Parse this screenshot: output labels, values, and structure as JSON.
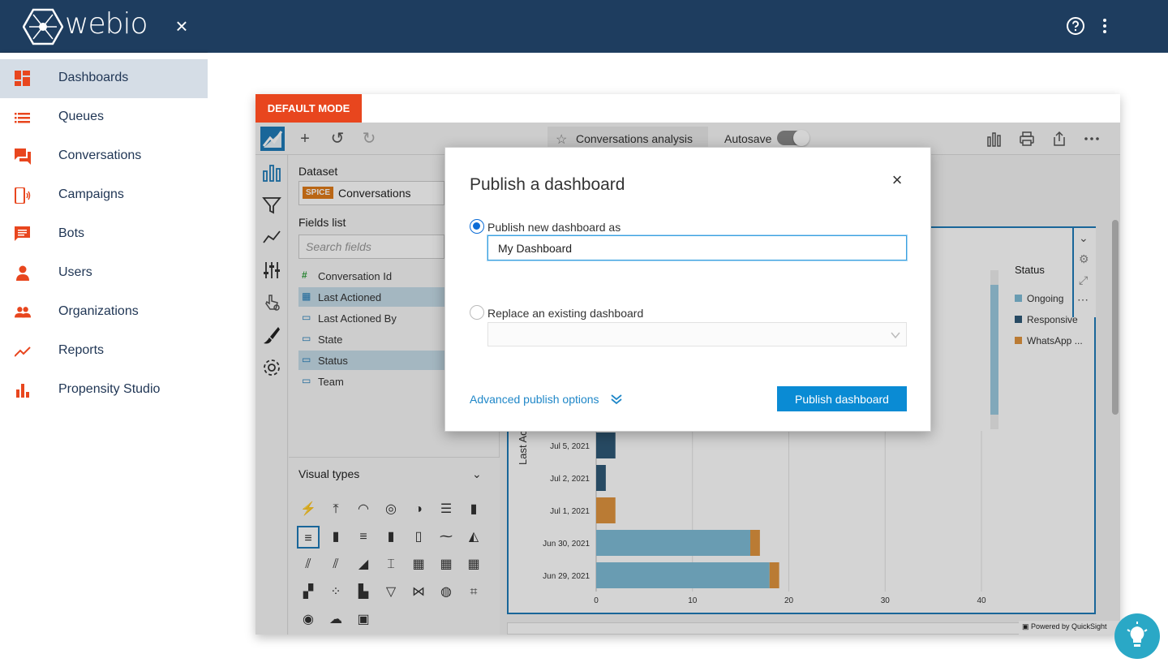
{
  "app": {
    "name": "webio",
    "close_label": "×"
  },
  "sidebar": {
    "items": [
      {
        "label": "Dashboards",
        "icon": "dashboard-icon"
      },
      {
        "label": "Queues",
        "icon": "list-icon"
      },
      {
        "label": "Conversations",
        "icon": "chat-icon"
      },
      {
        "label": "Campaigns",
        "icon": "phone-icon"
      },
      {
        "label": "Bots",
        "icon": "message-icon"
      },
      {
        "label": "Users",
        "icon": "person-icon"
      },
      {
        "label": "Organizations",
        "icon": "group-icon"
      },
      {
        "label": "Reports",
        "icon": "trend-icon"
      },
      {
        "label": "Propensity Studio",
        "icon": "bar-chart-icon"
      }
    ],
    "active_index": 0
  },
  "banner": {
    "mode_label": "DEFAULT MODE"
  },
  "quicksight": {
    "analysis_title": "Conversations analysis",
    "autosave_label": "Autosave",
    "dataset_label": "Dataset",
    "spice_badge": "SPICE",
    "dataset_name": "Conversations",
    "fields_list_label": "Fields list",
    "search_placeholder": "Search fields",
    "fields": [
      {
        "name": "Conversation Id",
        "type": "number",
        "selected": false
      },
      {
        "name": "Last Actioned",
        "type": "date",
        "selected": true
      },
      {
        "name": "Last Actioned By",
        "type": "dimension",
        "selected": false
      },
      {
        "name": "State",
        "type": "dimension",
        "selected": false
      },
      {
        "name": "Status",
        "type": "dimension",
        "selected": true
      },
      {
        "name": "Team",
        "type": "dimension",
        "selected": false
      }
    ],
    "visual_types_label": "Visual types",
    "powered_by": "Powered by QuickSight"
  },
  "chart_data": {
    "type": "bar",
    "orientation": "horizontal",
    "stacked": true,
    "ylabel": "Last Ac",
    "categories": [
      "Jul 5, 2021",
      "Jul 2, 2021",
      "Jul 1, 2021",
      "Jun 30, 2021",
      "Jun 29, 2021"
    ],
    "series": [
      {
        "name": "Ongoing",
        "color": "#7fbcd6",
        "values": [
          0,
          0,
          0,
          16,
          18
        ]
      },
      {
        "name": "Responsive",
        "color": "#2f5a78",
        "values": [
          2,
          1,
          0,
          0,
          0
        ]
      },
      {
        "name": "WhatsApp ...",
        "color": "#e0953f",
        "values": [
          0,
          0,
          2,
          1,
          1
        ]
      }
    ],
    "xticks": [
      "0",
      "10",
      "20",
      "30",
      "40"
    ],
    "xlim": [
      0,
      40
    ],
    "legend_title": "Status",
    "legend_position": "top-right"
  },
  "modal": {
    "title": "Publish a dashboard",
    "close_label": "×",
    "option_new_label": "Publish new dashboard as",
    "name_value": "My Dashboard",
    "option_replace_label": "Replace an existing dashboard",
    "advanced_label": "Advanced publish options",
    "publish_button": "Publish dashboard"
  }
}
